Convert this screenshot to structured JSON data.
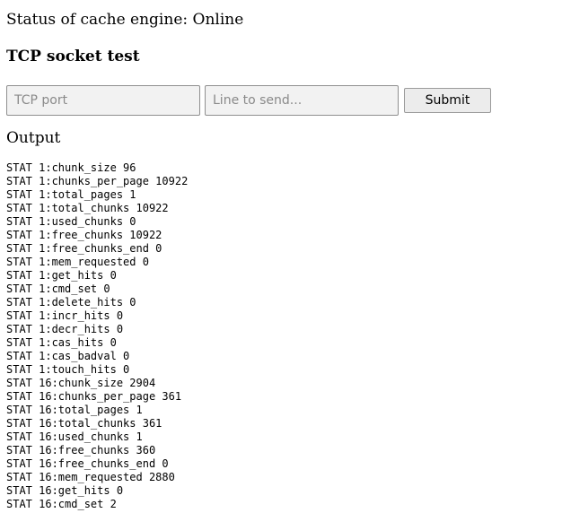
{
  "status": {
    "text": "Status of cache engine: Online"
  },
  "tcp_test": {
    "heading": "TCP socket test",
    "port_placeholder": "TCP port",
    "port_value": "",
    "line_placeholder": "Line to send...",
    "line_value": "",
    "submit_label": "Submit"
  },
  "output": {
    "label": "Output",
    "lines": [
      "STAT 1:chunk_size 96",
      "STAT 1:chunks_per_page 10922",
      "STAT 1:total_pages 1",
      "STAT 1:total_chunks 10922",
      "STAT 1:used_chunks 0",
      "STAT 1:free_chunks 10922",
      "STAT 1:free_chunks_end 0",
      "STAT 1:mem_requested 0",
      "STAT 1:get_hits 0",
      "STAT 1:cmd_set 0",
      "STAT 1:delete_hits 0",
      "STAT 1:incr_hits 0",
      "STAT 1:decr_hits 0",
      "STAT 1:cas_hits 0",
      "STAT 1:cas_badval 0",
      "STAT 1:touch_hits 0",
      "STAT 16:chunk_size 2904",
      "STAT 16:chunks_per_page 361",
      "STAT 16:total_pages 1",
      "STAT 16:total_chunks 361",
      "STAT 16:used_chunks 1",
      "STAT 16:free_chunks 360",
      "STAT 16:free_chunks_end 0",
      "STAT 16:mem_requested 2880",
      "STAT 16:get_hits 0",
      "STAT 16:cmd_set 2"
    ]
  }
}
